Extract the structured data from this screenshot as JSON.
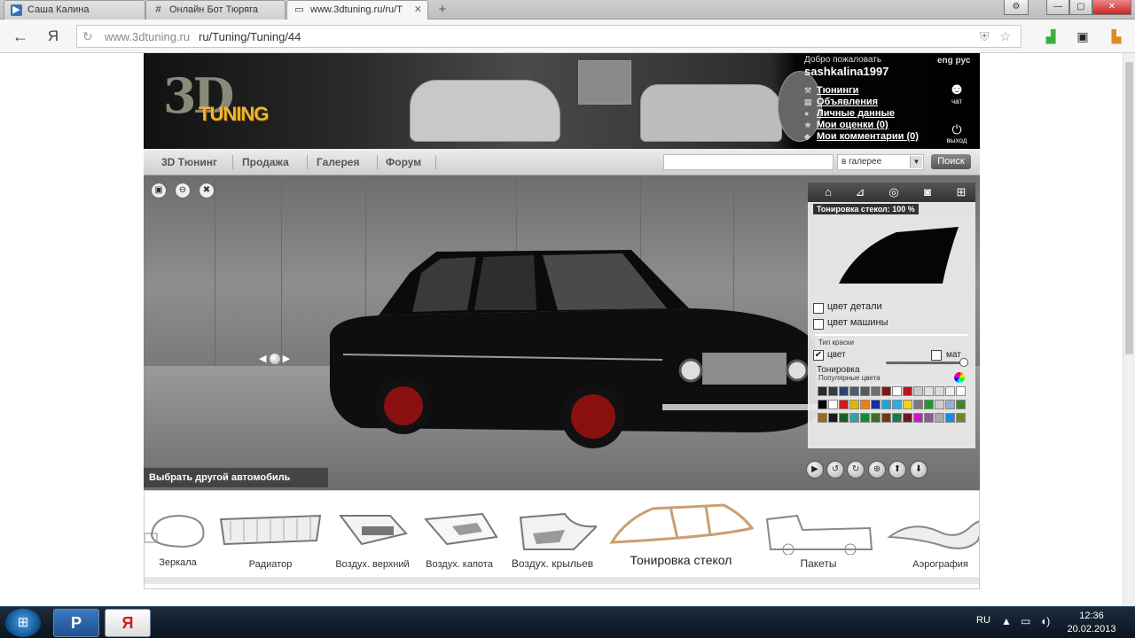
{
  "browser": {
    "tabs": [
      {
        "label": "Саша Калина"
      },
      {
        "label": "Онлайн Бот Тюряга"
      },
      {
        "label": "www.3dtuning.ru/ru/T"
      }
    ],
    "new_tab_symbol": "+",
    "window_controls": {
      "settings": "⚙",
      "minimize": "—",
      "maximize": "▢",
      "close": "✕"
    },
    "address": {
      "host": "www.3dtuning.ru",
      "path": "ru/Tuning/Tuning/44"
    },
    "extension_icons": [
      "signal-icon",
      "camera-icon",
      "bag-icon"
    ]
  },
  "site": {
    "logo": {
      "part1": "3D",
      "part2": "TUNING"
    },
    "user": {
      "welcome": "Добро пожаловать",
      "username": "sashkalina1997",
      "lang": "eng рус",
      "menu": [
        {
          "label": "Тюнинги",
          "icon": "wrench-icon"
        },
        {
          "label": "Объявления",
          "icon": "cart-icon"
        },
        {
          "label": "Личные данные",
          "icon": "person-icon"
        },
        {
          "label": "Мои оценки (0)",
          "icon": "star-icon"
        },
        {
          "label": "Мои комментарии (0)",
          "icon": "comment-icon"
        }
      ],
      "chat_label": "чат",
      "logout_label": "выход"
    },
    "nav": [
      {
        "label": "3D Тюнинг"
      },
      {
        "label": "Продажа"
      },
      {
        "label": "Галерея"
      },
      {
        "label": "Форум"
      }
    ],
    "search": {
      "select_value": "в галерее",
      "button_label": "Поиск"
    },
    "viewer": {
      "choose_car": "Выбрать другой автомобиль",
      "panel": {
        "tint_label": "Тонировка стекол: 100 %",
        "tint_value_percent": 100,
        "part_color_label": "цвет детали",
        "car_color_label": "цвет машины",
        "paint_type_label": "Тип краски",
        "color_label": "цвет",
        "matte_label": "мат",
        "toning_label": "Тонировка",
        "toning_level": 1.0,
        "popular_colors_label": "Популярные цвета",
        "swatches": [
          "#2a2a2a",
          "#333a44",
          "#2d3f73",
          "#4e5d6b",
          "#5a5a5a",
          "#6e6e6e",
          "#7a1a14",
          "#ffffff",
          "#c0151c",
          "#c9c9c9",
          "#e0e0e0",
          "#dcdcdc",
          "#eeeeee",
          "#ffffff",
          "#000000",
          "#ffffff",
          "#d01818",
          "#e6b400",
          "#f07f10",
          "#1530a0",
          "#1ba5d6",
          "#2ab0e0",
          "#f0d020",
          "#7a7a7a",
          "#1c9c2a",
          "#cccccc",
          "#9ab0c8",
          "#3a8a2a",
          "#a0691c",
          "#1a1a1a",
          "#1b5e20",
          "#35a0a8",
          "#148a3c",
          "#3c6e2a",
          "#6b3c10",
          "#207848",
          "#6a1530",
          "#c818c8",
          "#8a5a8a",
          "#a8a8a8",
          "#1e88e5",
          "#6a8a20"
        ]
      }
    },
    "parts": [
      {
        "label": "Зеркала"
      },
      {
        "label": "Радиатор"
      },
      {
        "label": "Воздух. верхний"
      },
      {
        "label": "Воздух. капота"
      },
      {
        "label": "Воздух. крыльев"
      },
      {
        "label": "Тонировка стекол"
      },
      {
        "label": "Пакеты"
      },
      {
        "label": "Аэрография"
      }
    ]
  },
  "taskbar": {
    "apps": [
      {
        "label": "P"
      },
      {
        "label": "Я"
      }
    ],
    "lang": "RU",
    "time": "12:36",
    "date": "20.02.2013"
  }
}
